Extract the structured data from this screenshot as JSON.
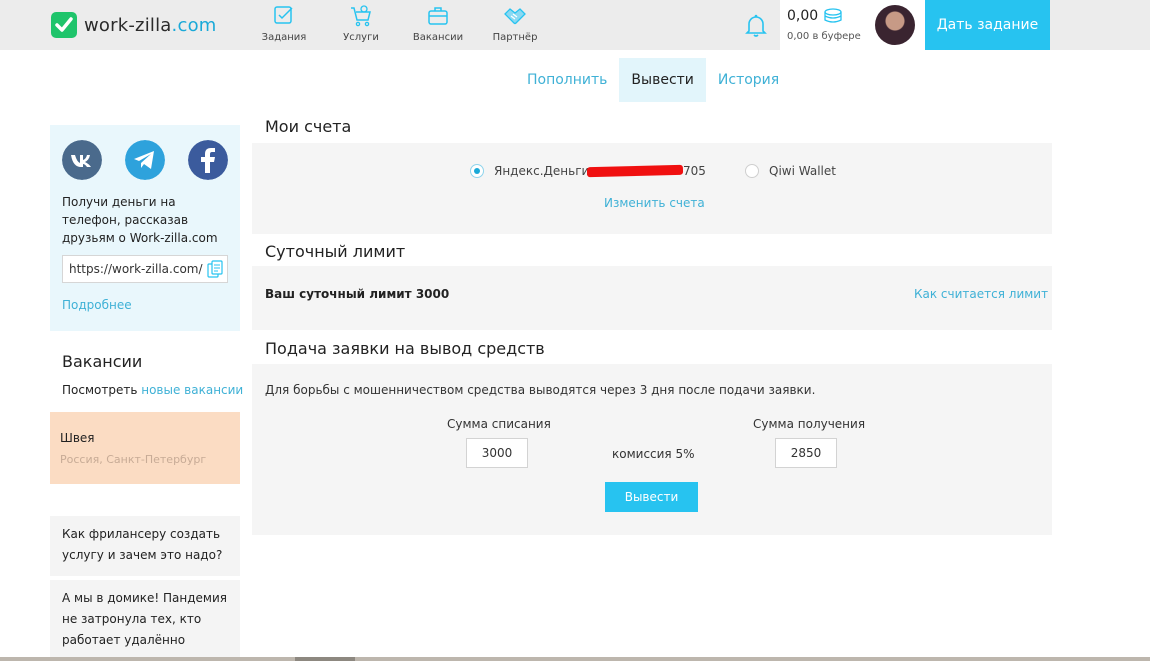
{
  "header": {
    "logo": {
      "part1": "work-zilla",
      "part2": ".com"
    },
    "nav": [
      {
        "label": "Задания",
        "icon": "tasks-icon"
      },
      {
        "label": "Услуги",
        "icon": "services-cart-icon"
      },
      {
        "label": "Вакансии",
        "icon": "briefcase-icon"
      },
      {
        "label": "Партнёр",
        "icon": "handshake-icon"
      }
    ],
    "balance": {
      "amount": "0,00",
      "buffer": "0,00 в буфере"
    },
    "give_task_label": "Дать задание"
  },
  "tabs": [
    {
      "label": "Пополнить",
      "active": false
    },
    {
      "label": "Вывести",
      "active": true
    },
    {
      "label": "История",
      "active": false
    }
  ],
  "sidebar": {
    "social": [
      "vk-icon",
      "telegram-icon",
      "facebook-icon"
    ],
    "referral_text": "Получи деньги на телефон, рассказав друзьям о Work-zilla.com",
    "referral_link": "https://work-zilla.com/",
    "more_label": "Подробнее",
    "vacancies": {
      "title": "Вакансии",
      "prefix": "Посмотреть ",
      "link": "новые вакансии",
      "card": {
        "title": "Швея",
        "location": "Россия, Санкт-Петербург"
      }
    },
    "articles": [
      "Как фрилансеру создать услугу и зачем это надо?",
      "А мы в домике! Пандемия не затронула тех, кто работает удалённо"
    ]
  },
  "accounts": {
    "title": "Мои счета",
    "options": [
      {
        "label": "Яндекс.Деньги",
        "number_suffix": "705",
        "selected": true
      },
      {
        "label": "Qiwi Wallet",
        "selected": false
      }
    ],
    "change_label": "Изменить счета"
  },
  "limit": {
    "title": "Суточный лимит",
    "text": "Ваш суточный лимит 3000",
    "how_label": "Как считается лимит"
  },
  "withdraw": {
    "title": "Подача заявки на вывод средств",
    "notice": "Для борьбы с мошенничеством средства выводятся через 3 дня после подачи заявки.",
    "debit_label": "Сумма списания",
    "debit_value": "3000",
    "commission": "комиссия 5%",
    "receive_label": "Сумма получения",
    "receive_value": "2850",
    "button_label": "Вывести"
  },
  "colors": {
    "accent": "#27c3f0",
    "link": "#3fb1d6",
    "logo_green": "#1fc46b"
  }
}
